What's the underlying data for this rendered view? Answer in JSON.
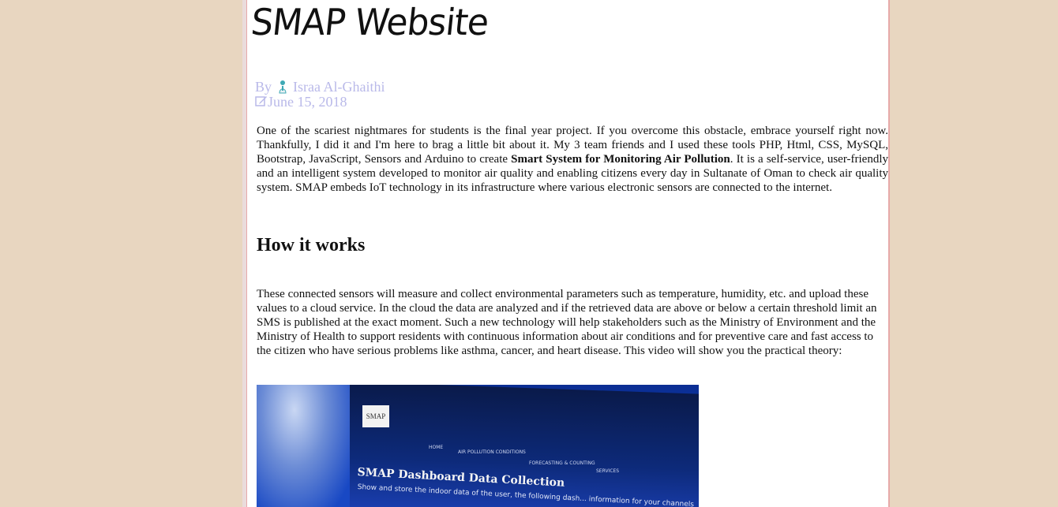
{
  "post": {
    "title": "SMAP Website",
    "by_label": "By",
    "author": "Israa Al-Ghaithi",
    "date": "June 15, 2018"
  },
  "intro": {
    "part1": "One of the scariest nightmares for students is the final year project. If you overcome this obstacle, embrace yourself right now. Thankfully, I did it and I'm here to brag a little bit about it. My 3 team friends and I used these tools PHP, Html, CSS, MySQL, Bootstrap, JavaScript, Sensors and Arduino to create ",
    "bold": "Smart System for Monitoring Air Pollution",
    "part2": ". It is a self-service, user-friendly and an intelligent system developed to monitor air quality and enabling citizens every day in Sultanate of Oman to check air quality system. SMAP embeds IoT technology in its infrastructure where various electronic sensors are connected to the internet."
  },
  "section": {
    "heading": "How it works",
    "body": "These connected sensors will measure and collect environmental parameters such as temperature, humidity, etc. and upload these values to a cloud service. In the cloud the data are analyzed and if the retrieved data are above or below a certain threshold limit an SMS is published at the exact moment. Such a new technology will help stakeholders such as the Ministry of Environment and the Ministry of Health to support residents with continuous information about air conditions and for preventive care and fast access to the citizen who have serious problems like asthma, cancer, and heart disease. This video will show you the practical theory:"
  },
  "video": {
    "logo_text": "SMAP",
    "nav": [
      "HOME",
      "AIR POLLUTION CONDITIONS",
      "FORECASTING & COUNTING",
      "SERVICES"
    ],
    "heading": "SMAP Dashboard Data Collection",
    "subtext": "Show and store the indoor data of the user, the following dash... information for your channels"
  },
  "colors": {
    "background": "#e8d6c0",
    "meta": "#b9b9e9",
    "border": "#e6a9a9"
  },
  "icons": {
    "author": "person-icon",
    "date": "edit-icon"
  }
}
